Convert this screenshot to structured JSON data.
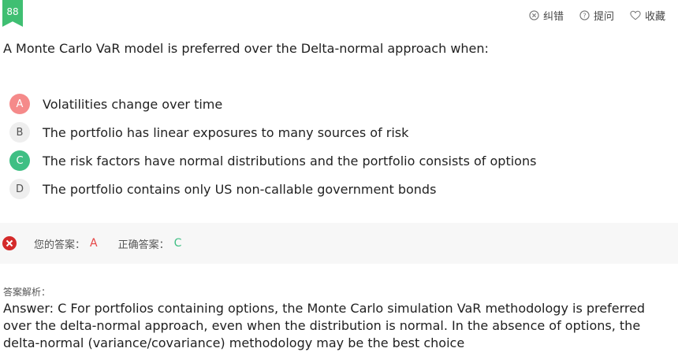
{
  "question_number": "88",
  "actions": {
    "report_label": "纠错",
    "ask_label": "提问",
    "favorite_label": "收藏"
  },
  "question": {
    "text": "A Monte Carlo VaR model is preferred over the Delta-normal approach when:"
  },
  "options": [
    {
      "letter": "A",
      "text": "Volatilities change over time",
      "state": "wrong"
    },
    {
      "letter": "B",
      "text": "The portfolio has linear exposures to many sources of risk",
      "state": "neutral"
    },
    {
      "letter": "C",
      "text": "The risk factors have normal distributions and the portfolio consists of options",
      "state": "right"
    },
    {
      "letter": "D",
      "text": "The portfolio contains only US non-callable government bonds",
      "state": "neutral"
    }
  ],
  "result": {
    "your_answer_label": "您的答案：",
    "your_answer": "A",
    "correct_answer_label": "正确答案：",
    "correct_answer": "C"
  },
  "analysis": {
    "title": "答案解析：",
    "text": "Answer: C For portfolios containing options, the Monte Carlo simulation VaR methodology is preferred over the delta-normal approach, even when the distribution is normal. In the absence of options, the delta-normal (variance/covariance) methodology may be the best choice"
  },
  "colors": {
    "badge": "#3fbf72",
    "wrong": "#e64545",
    "right": "#3fbf84"
  }
}
